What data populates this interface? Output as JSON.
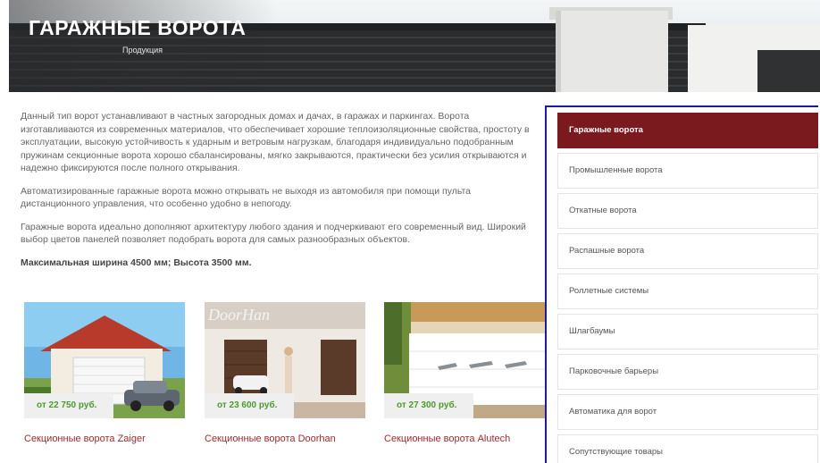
{
  "banner": {
    "title": "ГАРАЖНЫЕ ВОРОТА",
    "breadcrumb": "Продукция"
  },
  "content": {
    "paragraphs": [
      "Данный тип ворот устанавливают в частных загородных домах и дачах, в гаражах и паркингах. Ворота изготавливаются из современных материалов, что обеспечивает хорошие теплоизоляционные свойства, простоту в эксплуатации, высокую устойчивость к ударным и ветровым нагрузкам, благодаря индивидуально подобранным пружинам секционные ворота хорошо сбалансированы, мягко закрываются, практически без усилия открываются и надежно фиксируются после полного открывания.",
      "Автоматизированные гаражные ворота можно открывать не выходя из автомобиля при помощи пульта дистанционного управления, что особенно удобно в непогоду.",
      "Гаражные ворота идеально дополняют архитектуру любого здания и подчеркивают его современный вид. Широкий выбор цветов панелей позволяет подобрать ворота для самых разнообразных объектов."
    ],
    "dimensions": "Максимальная ширина 4500 мм; Высота 3500 мм."
  },
  "products": [
    {
      "name": "Секционные ворота Zaiger",
      "price": "от 22 750 руб."
    },
    {
      "name": "Секционные ворота Doorhan",
      "price": "от 23 600 руб.",
      "watermark": "DoorHan"
    },
    {
      "name": "Секционные ворота Alutech",
      "price": "от 27 300 руб."
    }
  ],
  "sidebar": {
    "items": [
      {
        "label": "Гаражные ворота",
        "active": true
      },
      {
        "label": "Промышленные ворота"
      },
      {
        "label": "Откатные ворота"
      },
      {
        "label": "Распашные ворота"
      },
      {
        "label": "Роллетные системы"
      },
      {
        "label": "Шлагбаумы"
      },
      {
        "label": "Парковочные барьеры"
      },
      {
        "label": "Автоматика для ворот"
      },
      {
        "label": "Сопутствующие товары"
      }
    ]
  },
  "colors": {
    "accent": "#7a1a1e",
    "price": "#4e9a2f",
    "link": "#a12a2f",
    "highlight_border": "#1a1aa6"
  }
}
